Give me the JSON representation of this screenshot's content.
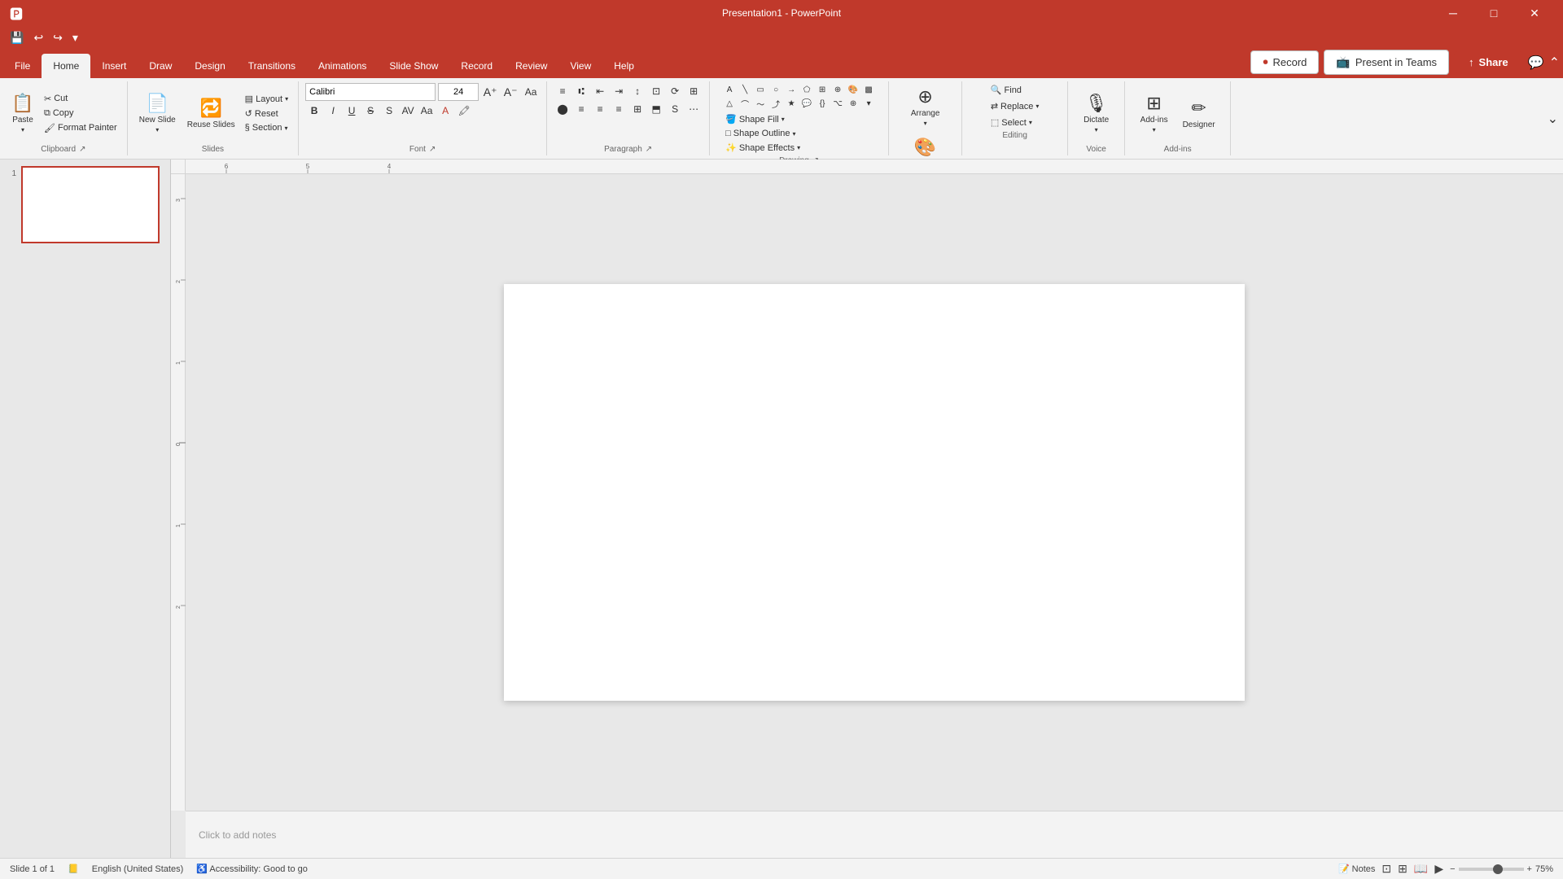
{
  "titleBar": {
    "title": "Presentation1 - PowerPoint",
    "buttons": [
      "minimize",
      "maximize",
      "close"
    ]
  },
  "qat": {
    "buttons": [
      "save",
      "undo",
      "redo",
      "customize"
    ]
  },
  "ribbonTabs": {
    "tabs": [
      "File",
      "Home",
      "Insert",
      "Draw",
      "Design",
      "Transitions",
      "Animations",
      "Slide Show",
      "Record",
      "Review",
      "View",
      "Help"
    ],
    "activeTab": "Home"
  },
  "ribbon": {
    "record_label": "Record",
    "present_label": "Present in Teams",
    "share_label": "Share",
    "groups": {
      "clipboard": {
        "label": "Clipboard",
        "paste_label": "Paste",
        "cut_label": "Cut",
        "copy_label": "Copy",
        "format_painter_label": "Format Painter"
      },
      "slides": {
        "label": "Slides",
        "new_slide_label": "New Slide",
        "layout_label": "Layout",
        "reset_label": "Reset",
        "reuse_slides_label": "Reuse Slides",
        "section_label": "Section"
      },
      "font": {
        "label": "Font",
        "font_name": "Calibri",
        "font_size": "24",
        "bold_label": "B",
        "italic_label": "I",
        "underline_label": "U",
        "strikethrough_label": "S",
        "expand_icon": "↗"
      },
      "paragraph": {
        "label": "Paragraph",
        "align_left": "Left",
        "align_center": "Center",
        "align_right": "Right",
        "justify": "Justify"
      },
      "drawing": {
        "label": "Drawing",
        "arrange_label": "Arrange",
        "quick_styles_label": "Quick Styles",
        "shape_fill_label": "Shape Fill",
        "shape_outline_label": "Shape Outline",
        "shape_effects_label": "Shape Effects"
      },
      "editing": {
        "label": "Editing",
        "find_label": "Find",
        "replace_label": "Replace",
        "select_label": "Select"
      },
      "voice": {
        "label": "Voice",
        "dictate_label": "Dictate"
      },
      "addins": {
        "label": "Add-ins",
        "addins_label": "Add-ins",
        "designer_label": "Designer"
      }
    }
  },
  "slidePanel": {
    "slideNumber": "1"
  },
  "editor": {
    "notesPlaceholder": "Click to add notes"
  },
  "statusBar": {
    "slideInfo": "Slide 1 of 1",
    "language": "English (United States)",
    "accessibility": "Accessibility: Good to go",
    "notesLabel": "Notes",
    "zoomLevel": "75%"
  }
}
